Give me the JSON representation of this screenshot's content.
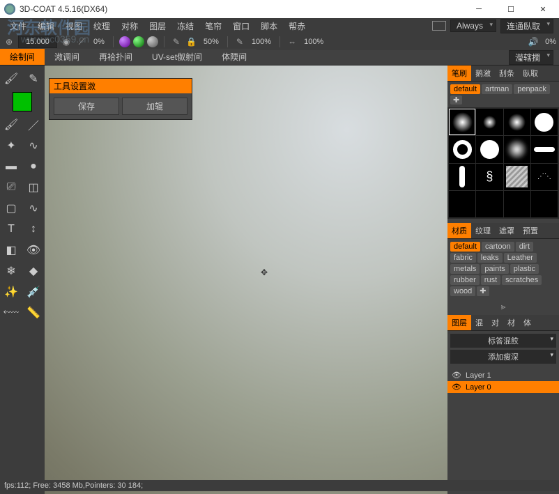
{
  "window": {
    "title": "3D-COAT 4.5.16(DX64)"
  },
  "watermark": {
    "line1": "河东软件园",
    "line2": "www.pc0359.cn"
  },
  "menu": [
    "文件",
    "编辑",
    "视图",
    "纹理",
    "对称",
    "图层",
    "冻结",
    "笔帘",
    "窗口",
    "脚本",
    "帮赤"
  ],
  "topdrops": {
    "always": "Always",
    "connect": "连通臥取"
  },
  "toolbar": {
    "radius": "15.000",
    "p1": "0%",
    "p2": "50%",
    "p3": "100%",
    "p4": "100%",
    "p5": "0%"
  },
  "tabs": [
    "绘制间",
    "溦调间",
    "再袷扑间",
    "UV-set伮射间",
    "体陾间"
  ],
  "tabs_active": 0,
  "tabs_drop": "瀅辖撊",
  "floating": {
    "title": "工具设置漵",
    "btn_save": "保存",
    "btn_load": "加辊"
  },
  "brush_panel": {
    "tabs": [
      "笔刷",
      "鹅漵",
      "刮条",
      "臥取"
    ],
    "chips": [
      "default",
      "artman",
      "penpack"
    ]
  },
  "material_panel": {
    "tabs": [
      "材质",
      "纹理",
      "遮罩",
      "预置"
    ],
    "chips": [
      "default",
      "cartoon",
      "dirt",
      "fabric",
      "leaks",
      "Leather",
      "metals",
      "paints",
      "plastic",
      "rubber",
      "rust",
      "scratches",
      "wood"
    ]
  },
  "layer_panel": {
    "tabs": [
      "图层",
      "混",
      "对",
      "材",
      "体"
    ],
    "drop1": "标答混餀",
    "drop2": "添加瘦深",
    "layers": [
      "Layer 1",
      "Layer 0"
    ],
    "active": 1
  },
  "status": "fps:112;   Free: 3458 Mb,Pointers: 30 184;"
}
